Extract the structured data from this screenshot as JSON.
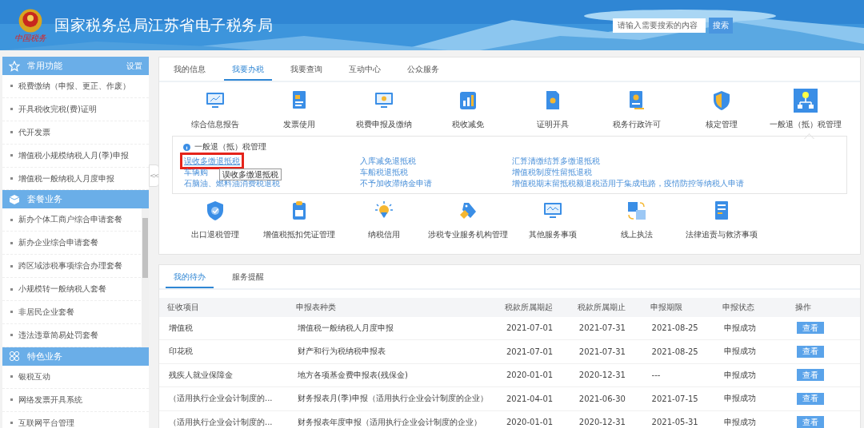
{
  "header": {
    "title": "国家税务总局江苏省电子税务局",
    "emblem_caption": "中国税务",
    "search": {
      "placeholder": "请输入需要搜索的内容",
      "button": "搜索"
    }
  },
  "sidebar": {
    "sections": [
      {
        "title": "常用功能",
        "action": "设置",
        "items": [
          "税费缴纳（申报、更正、作废）",
          "开具税收完税(费)证明",
          "代开发票",
          "增值税小规模纳税人月(季)申报",
          "增值税一般纳税人月度申报"
        ]
      },
      {
        "title": "套餐业务",
        "items": [
          "新办个体工商户综合申请套餐",
          "新办企业综合申请套餐",
          "跨区域涉税事项综合办理套餐",
          "小规模转一般纳税人套餐",
          "非居民企业套餐",
          "违法违章简易处罚套餐"
        ]
      },
      {
        "title": "特色业务",
        "items": [
          "银税互动",
          "网络发票开具系统",
          "互联网平台管理"
        ]
      }
    ],
    "collapse": "<<"
  },
  "main_tabs": [
    {
      "label": "我的信息",
      "selected": false
    },
    {
      "label": "我要办税",
      "selected": true
    },
    {
      "label": "我要查询",
      "selected": false
    },
    {
      "label": "互动中心",
      "selected": false
    },
    {
      "label": "公众服务",
      "selected": false
    }
  ],
  "services": [
    {
      "label": "综合信息报告",
      "selected": false
    },
    {
      "label": "发票使用",
      "selected": false
    },
    {
      "label": "税费申报及缴纳",
      "selected": false
    },
    {
      "label": "税收减免",
      "selected": false
    },
    {
      "label": "证明开具",
      "selected": false
    },
    {
      "label": "税务行政许可",
      "selected": false
    },
    {
      "label": "核定管理",
      "selected": false
    },
    {
      "label": "一般退（抵）税管理",
      "selected": true
    }
  ],
  "submenu": {
    "title": "一般退（抵）税管理",
    "links": [
      {
        "label": "误收多缴退抵税",
        "highlighted": true
      },
      {
        "label": "入库减免退抵税",
        "highlighted": false
      },
      {
        "label": "汇算清缴结算多缴退抵税",
        "highlighted": false
      },
      {
        "label": "车辆购",
        "highlighted": false
      },
      {
        "label": "车船税退抵税",
        "highlighted": false
      },
      {
        "label": "增值税制度性留抵退税",
        "highlighted": false
      },
      {
        "label": "石脑油、燃料油消费税退税",
        "highlighted": false
      },
      {
        "label": "不予加收滞纳金申请",
        "highlighted": false
      },
      {
        "label": "增值税期末留抵税额退税适用于集成电路，疫情防控等纳税人申请",
        "highlighted": false
      }
    ],
    "tooltip": "误收多缴退抵税"
  },
  "services_more": [
    {
      "label": "出口退税管理"
    },
    {
      "label": "增值税抵扣凭证管理"
    },
    {
      "label": "纳税信用"
    },
    {
      "label": "涉税专业服务机构管理"
    },
    {
      "label": "其他服务事项"
    },
    {
      "label": "线上执法"
    },
    {
      "label": "法律追责与救济事项"
    }
  ],
  "todo_tabs": [
    {
      "label": "我的待办",
      "selected": true
    },
    {
      "label": "服务提醒",
      "selected": false
    }
  ],
  "table": {
    "columns": [
      "征收项目",
      "申报表种类",
      "税款所属期起",
      "税款所属期止",
      "申报期限",
      "申报状态",
      "操作"
    ],
    "rows": [
      {
        "cells": [
          "增值税",
          "增值税一般纳税人月度申报",
          "2021-07-01",
          "2021-07-31",
          "2021-08-25",
          "申报成功"
        ],
        "action": "查看"
      },
      {
        "cells": [
          "印花税",
          "财产和行为税纳税申报表",
          "2021-07-01",
          "2021-07-31",
          "2021-08-25",
          "申报成功"
        ],
        "action": "查看"
      },
      {
        "cells": [
          "残疾人就业保障金",
          "地方各项基金费申报表(残保金)",
          "2020-01-01",
          "2020-12-31",
          "---",
          "申报成功"
        ],
        "action": "查看"
      },
      {
        "cells": [
          "（适用执行企业会计制度的...",
          "财务报表月(季)申报（适用执行企业会计制度的企业）",
          "2021-04-01",
          "2021-06-30",
          "2021-07-15",
          "申报成功"
        ],
        "action": "查看"
      },
      {
        "cells": [
          "（适用执行企业会计制度的...",
          "财务报表年度申报（适用执行企业会计制度的企业）",
          "2020-01-01",
          "2020-12-31",
          "2021-05-31",
          "申报成功"
        ],
        "action": "查看"
      }
    ]
  }
}
